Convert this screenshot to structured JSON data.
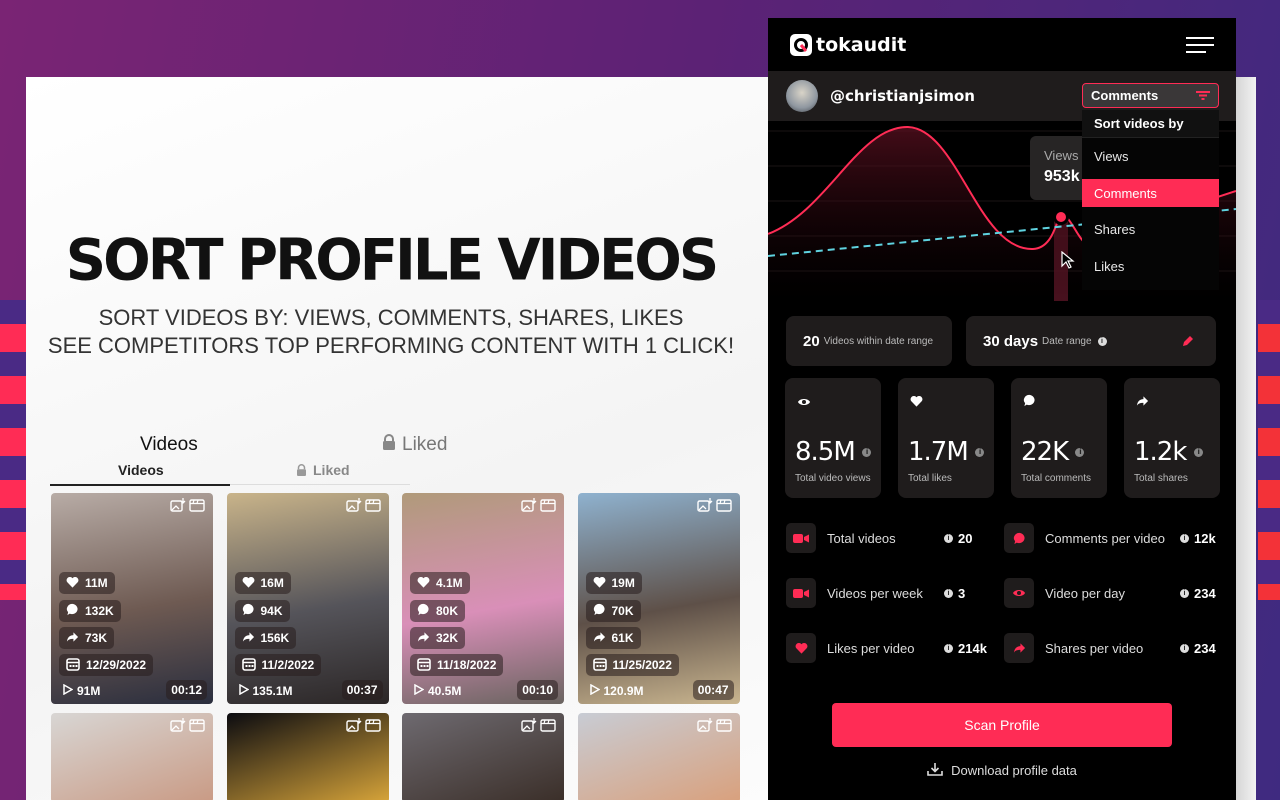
{
  "promo": {
    "headline": "SORT PROFILE VIDEOS",
    "subline1": "SORT VIDEOS BY: VIEWS, COMMENTS, SHARES, LIKES",
    "subline2": "SEE COMPETITORS TOP PERFORMING CONTENT WITH 1 CLICK!"
  },
  "profile_tabs": {
    "big": {
      "videos": "Videos",
      "liked": "Liked"
    },
    "small": {
      "videos": "Videos",
      "liked": "Liked"
    },
    "active": "Videos"
  },
  "videos": [
    {
      "likes": "11M",
      "comments": "132K",
      "shares": "73K",
      "date": "12/29/2022",
      "views": "91M",
      "duration": "00:12",
      "thumb_colors": [
        "#b8aca6",
        "#6e5a52",
        "#2a2e3e"
      ]
    },
    {
      "likes": "16M",
      "comments": "94K",
      "shares": "156K",
      "date": "11/2/2022",
      "views": "135.1M",
      "duration": "00:37",
      "thumb_colors": [
        "#c9b48a",
        "#55545a",
        "#2b2626"
      ]
    },
    {
      "likes": "4.1M",
      "comments": "80K",
      "shares": "32K",
      "date": "11/18/2022",
      "views": "40.5M",
      "duration": "00:10",
      "thumb_colors": [
        "#b09a7a",
        "#d98fb8",
        "#6a6460"
      ]
    },
    {
      "likes": "19M",
      "comments": "70K",
      "shares": "61K",
      "date": "11/25/2022",
      "views": "120.9M",
      "duration": "00:47",
      "thumb_colors": [
        "#8fb2cf",
        "#5e5048",
        "#c9b58f"
      ]
    }
  ],
  "videos_row2": [
    {
      "thumb_colors": [
        "#d8d6d4",
        "#c99a84"
      ]
    },
    {
      "thumb_colors": [
        "#0b0b10",
        "#d8a53a"
      ]
    },
    {
      "thumb_colors": [
        "#6e6a70",
        "#3a2e28"
      ]
    },
    {
      "thumb_colors": [
        "#c8ccd4",
        "#d9a07c"
      ]
    }
  ],
  "panel": {
    "brand": "tokaudit",
    "username": "@christianjsimon",
    "sort_select": {
      "value": "Comments"
    },
    "sort_menu": {
      "title": "Sort videos by",
      "options": [
        "Views",
        "Comments",
        "Shares",
        "Likes"
      ],
      "selected": "Comments"
    },
    "tooltip": {
      "label": "Views",
      "value": "953k"
    },
    "range": {
      "videos_count": "20",
      "videos_label": "Videos within date range",
      "days": "30 days",
      "days_label": "Date range"
    },
    "stats": [
      {
        "icon": "eye-icon",
        "value": "8.5M",
        "label": "Total video views"
      },
      {
        "icon": "heart-icon",
        "value": "1.7M",
        "label": "Total likes"
      },
      {
        "icon": "comment-icon",
        "value": "22K",
        "label": "Total comments"
      },
      {
        "icon": "share-icon",
        "value": "1.2k",
        "label": "Total shares"
      }
    ],
    "metrics": [
      {
        "icon": "video-camera-icon",
        "label": "Total videos",
        "value": "20"
      },
      {
        "icon": "comment-icon",
        "label": "Comments per video",
        "value": "12k"
      },
      {
        "icon": "video-camera-icon",
        "label": "Videos per week",
        "value": "3"
      },
      {
        "icon": "eye-icon",
        "label": "Video per day",
        "value": "234"
      },
      {
        "icon": "heart-icon",
        "label": "Likes per video",
        "value": "214k"
      },
      {
        "icon": "share-icon",
        "label": "Shares per video",
        "value": "234"
      }
    ],
    "scan_button": "Scan Profile",
    "download_link": "Download profile data",
    "colors": {
      "accent": "#ff2c55",
      "trend": "#5fd3e0",
      "card": "#1f1c1c"
    }
  }
}
